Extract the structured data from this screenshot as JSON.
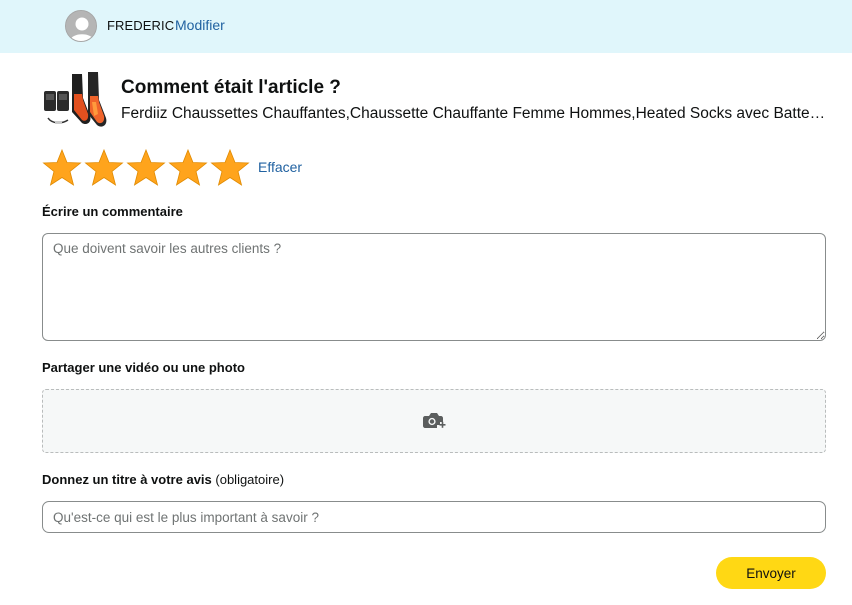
{
  "user": {
    "name": "FREDERIC",
    "modify_label": "Modifier",
    "avatar_icon": "user-silhouette-icon"
  },
  "product": {
    "question": "Comment était l'article ?",
    "name": "Ferdiiz Chaussettes Chauffantes,Chaussette Chauffante Femme Hommes,Heated Socks avec Batterie Rechargeable",
    "image_icon": "heated-socks-product-image"
  },
  "rating": {
    "value": 5,
    "max": 5,
    "star_color": "#ffa41c",
    "clear_label": "Effacer"
  },
  "comment": {
    "label": "Écrire un commentaire",
    "value": "",
    "placeholder": "Que doivent savoir les autres clients ?"
  },
  "media": {
    "label": "Partager une vidéo ou une photo",
    "icon": "camera-plus-icon"
  },
  "review_title": {
    "label": "Donnez un titre à votre avis",
    "label_suffix": "(obligatoire)",
    "value": "",
    "placeholder": "Qu'est-ce qui est le plus important à savoir ?"
  },
  "submit": {
    "label": "Envoyer",
    "color": "#ffd814"
  },
  "colors": {
    "header_bg": "#e0f6fb",
    "link": "#2162a1"
  }
}
